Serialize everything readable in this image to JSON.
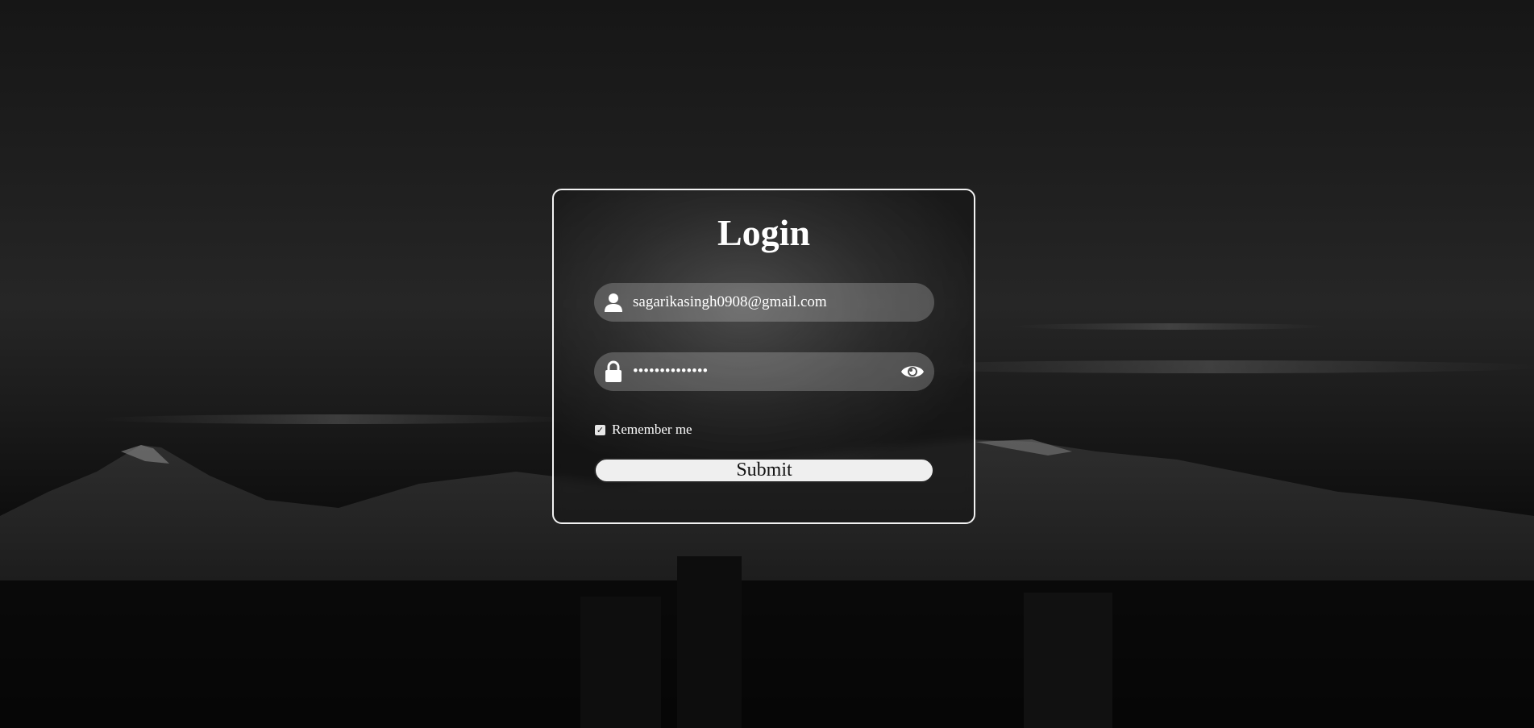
{
  "form": {
    "title": "Login",
    "email_value": "sagarikasingh0908@gmail.com",
    "password_value": "passwordpasswo",
    "remember_label": "Remember me",
    "remember_checked": true,
    "submit_label": "Submit"
  },
  "icons": {
    "email": "user-icon",
    "password": "lock-icon",
    "toggle": "eye-icon"
  },
  "colors": {
    "panel_border": "#f2f2f2",
    "text": "#ffffff",
    "button_bg": "#efefef"
  }
}
